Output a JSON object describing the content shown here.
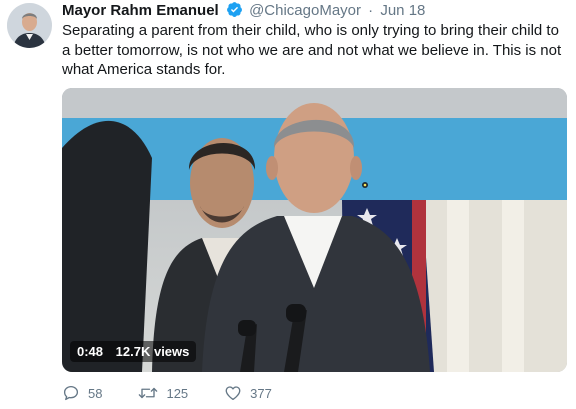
{
  "tweet": {
    "author_name": "Mayor Rahm Emanuel",
    "handle": "@ChicagoMayor",
    "separator": "·",
    "date": "Jun 18",
    "text": "Separating a parent from their child, who is only trying to bring their child to a better tomorrow, is not who we are and not what we believe in. This is not what America stands for.",
    "verified_icon": "verified-badge-icon",
    "colors": {
      "verified": "#1da1f2",
      "secondary": "#657786"
    }
  },
  "video": {
    "duration": "0:48",
    "views": "12.7K views"
  },
  "actions": {
    "replies": "58",
    "retweets": "125",
    "likes": "377",
    "icons": [
      "reply-icon",
      "retweet-icon",
      "like-icon"
    ]
  }
}
